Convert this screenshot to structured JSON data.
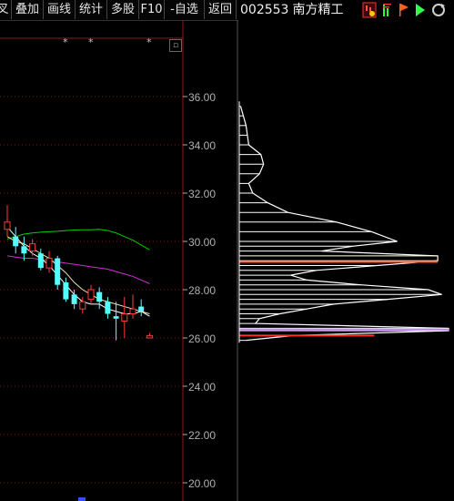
{
  "toolbar": {
    "buttons": [
      "叉",
      "叠加",
      "画线",
      "统计",
      "多股",
      "F10",
      "-自选",
      "返回"
    ]
  },
  "stock": {
    "code": "002553",
    "name": "南方精工"
  },
  "header_icons": [
    "chart-settings-icon",
    "volume-bars-icon",
    "flag-orange-icon",
    "play-green-icon",
    "refresh-icon"
  ],
  "price_axis": {
    "labels": [
      "36.00",
      "34.00",
      "32.00",
      "30.00",
      "28.00",
      "26.00",
      "24.00",
      "22.00",
      "20.00"
    ],
    "values": [
      36,
      34,
      32,
      30,
      28,
      26,
      24,
      22,
      20
    ]
  },
  "chart_data": [
    {
      "type": "candlestick",
      "candles": [
        {
          "o": 30.5,
          "c": 30.8,
          "h": 31.5,
          "l": 30.2,
          "color": "red"
        },
        {
          "o": 30.2,
          "c": 29.8,
          "h": 30.6,
          "l": 29.5,
          "color": "cyan"
        },
        {
          "o": 29.8,
          "c": 29.5,
          "h": 30.2,
          "l": 29.2,
          "color": "cyan"
        },
        {
          "o": 29.6,
          "c": 29.9,
          "h": 30.1,
          "l": 29.4,
          "color": "red"
        },
        {
          "o": 29.5,
          "c": 28.9,
          "h": 29.7,
          "l": 28.8,
          "color": "cyan"
        },
        {
          "o": 28.9,
          "c": 29.3,
          "h": 29.6,
          "l": 28.7,
          "color": "red"
        },
        {
          "o": 29.3,
          "c": 28.2,
          "h": 29.4,
          "l": 28.0,
          "color": "cyan"
        },
        {
          "o": 28.3,
          "c": 27.6,
          "h": 28.5,
          "l": 27.5,
          "color": "cyan"
        },
        {
          "o": 27.8,
          "c": 27.4,
          "h": 28.0,
          "l": 27.2,
          "color": "cyan"
        },
        {
          "o": 27.2,
          "c": 27.5,
          "h": 27.7,
          "l": 27.0,
          "color": "red"
        },
        {
          "o": 27.6,
          "c": 28.0,
          "h": 28.2,
          "l": 27.4,
          "color": "red"
        },
        {
          "o": 27.9,
          "c": 27.5,
          "h": 28.1,
          "l": 27.2,
          "color": "cyan"
        },
        {
          "o": 27.5,
          "c": 27.0,
          "h": 27.7,
          "l": 26.8,
          "color": "cyan"
        },
        {
          "o": 26.9,
          "c": 26.8,
          "h": 27.5,
          "l": 25.9,
          "color": "cyan"
        },
        {
          "o": 26.7,
          "c": 27.0,
          "h": 27.7,
          "l": 26.0,
          "color": "red"
        },
        {
          "o": 27.0,
          "c": 27.2,
          "h": 27.8,
          "l": 26.8,
          "color": "red"
        },
        {
          "o": 27.1,
          "c": 27.3,
          "h": 27.6,
          "l": 26.9,
          "color": "cyan"
        },
        {
          "o": 26.0,
          "c": 26.1,
          "h": 26.2,
          "l": 26.0,
          "color": "red"
        }
      ],
      "ma_lines": [
        {
          "color": "#00d000",
          "values": [
            30.1,
            30.2,
            30.3,
            30.35,
            30.38,
            30.4,
            30.42,
            30.45,
            30.47,
            30.48,
            30.48,
            30.5,
            30.45,
            30.35,
            30.2,
            30.05,
            29.85,
            29.65
          ]
        },
        {
          "color": "#d030d0",
          "values": [
            29.4,
            29.35,
            29.3,
            29.3,
            29.25,
            29.2,
            29.15,
            29.1,
            29.05,
            29.0,
            28.95,
            28.9,
            28.85,
            28.75,
            28.65,
            28.55,
            28.4,
            28.25
          ]
        },
        {
          "color": "#e8e8b0",
          "values": [
            30.2,
            30.0,
            29.9,
            29.7,
            29.5,
            29.3,
            29.0,
            28.7,
            28.3,
            28.0,
            27.8,
            27.6,
            27.5,
            27.4,
            27.3,
            27.2,
            27.1,
            27.0
          ]
        },
        {
          "color": "#ffffff",
          "values": [
            30.6,
            30.2,
            29.8,
            29.5,
            29.3,
            29.0,
            28.6,
            28.2,
            27.8,
            27.5,
            27.4,
            27.4,
            27.2,
            27.1,
            27.0,
            27.0,
            27.1,
            26.9
          ]
        }
      ]
    },
    {
      "type": "volume-profile",
      "price_levels": [
        35.6,
        35.2,
        34.8,
        34.4,
        34.0,
        33.6,
        33.2,
        32.8,
        32.4,
        32.0,
        31.6,
        31.2,
        30.8,
        30.4,
        30.0,
        29.8,
        29.6,
        29.4,
        29.2,
        29.0,
        28.8,
        28.6,
        28.4,
        28.2,
        28.0,
        27.8,
        27.6,
        27.4,
        27.2,
        27.0,
        26.8,
        26.6,
        26.4,
        26.3,
        26.1,
        25.9
      ],
      "volumes": [
        0.1,
        0.3,
        0.5,
        0.6,
        0.7,
        1.6,
        1.8,
        1.5,
        0.7,
        1.0,
        2.1,
        3.6,
        7.2,
        9.8,
        11.7,
        8.4,
        6.1,
        14.7,
        14.7,
        10.2,
        5.7,
        3.8,
        5.0,
        9.0,
        14.0,
        15.0,
        11.0,
        7.0,
        5.0,
        3.0,
        1.5,
        1.2,
        15.5,
        15.5,
        4.0,
        0.5
      ],
      "highlight_levels": [
        {
          "price": 29.15,
          "color": "#ff5020",
          "value": 14.7
        },
        {
          "price": 26.35,
          "color": "#c080ff",
          "value": 15.5
        },
        {
          "price": 26.1,
          "color": "#ff3030",
          "value": 10.0
        }
      ]
    }
  ],
  "colors": {
    "bg": "#000000",
    "up": "#ff3b3b",
    "down": "#54ffff",
    "axis": "#b0b0b0",
    "grid": "#7a1a1a"
  }
}
